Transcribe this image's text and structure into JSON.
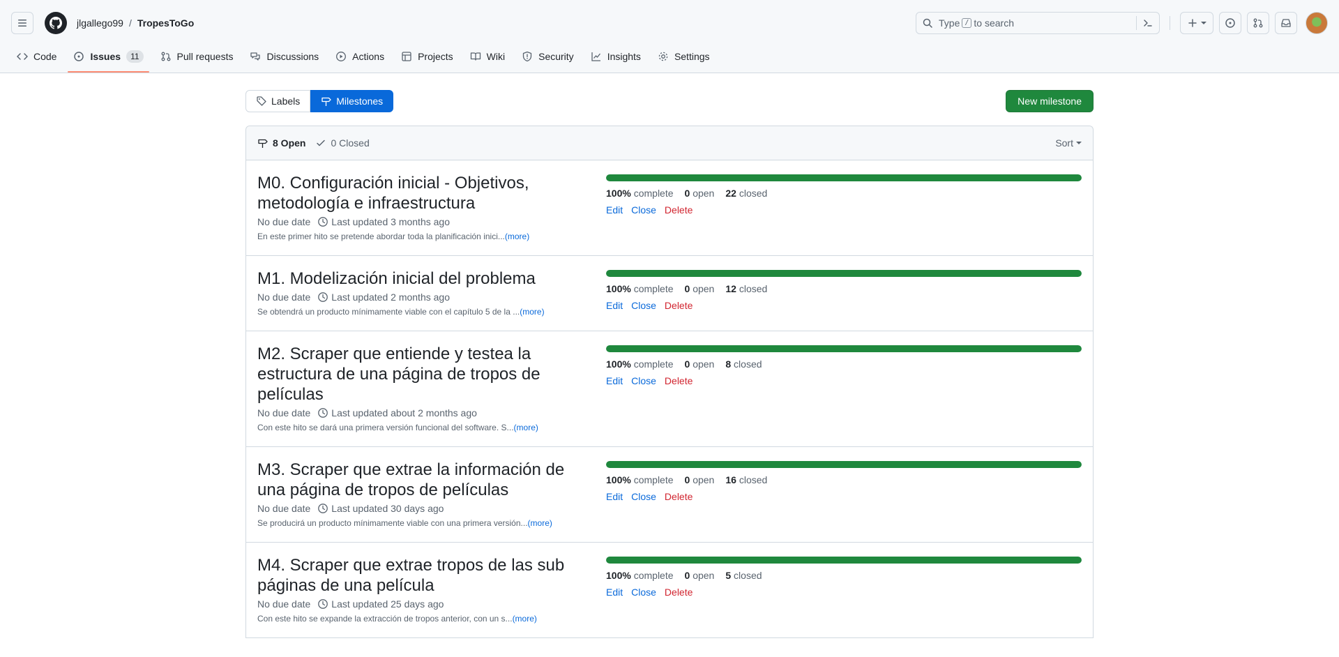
{
  "header": {
    "owner": "jlgallego99",
    "separator": "/",
    "repo": "TropesToGo",
    "search_prefix": "Type",
    "search_key": "/",
    "search_suffix": "to search"
  },
  "nav": {
    "tabs": [
      {
        "label": "Code",
        "icon": "code-icon"
      },
      {
        "label": "Issues",
        "icon": "issue-opened-icon",
        "count": "11",
        "active": true
      },
      {
        "label": "Pull requests",
        "icon": "git-pull-request-icon"
      },
      {
        "label": "Discussions",
        "icon": "comment-discussion-icon"
      },
      {
        "label": "Actions",
        "icon": "play-icon"
      },
      {
        "label": "Projects",
        "icon": "table-icon"
      },
      {
        "label": "Wiki",
        "icon": "book-icon"
      },
      {
        "label": "Security",
        "icon": "shield-icon"
      },
      {
        "label": "Insights",
        "icon": "graph-icon"
      },
      {
        "label": "Settings",
        "icon": "gear-icon"
      }
    ]
  },
  "toolbar": {
    "labels_label": "Labels",
    "milestones_label": "Milestones",
    "new_milestone_label": "New milestone"
  },
  "list": {
    "open_label": "8 Open",
    "closed_label": "0 Closed",
    "sort_label": "Sort"
  },
  "milestones": [
    {
      "title": "M0. Configuración inicial - Objetivos, metodología e infraestructura",
      "due": "No due date",
      "updated": "Last updated 3 months ago",
      "desc": "En este primer hito se pretende abordar toda la planificación inici...",
      "more": "(more)",
      "progress": 100,
      "percent": "100%",
      "complete_label": "complete",
      "open": "0",
      "open_label": "open",
      "closed": "22",
      "closed_label": "closed",
      "edit": "Edit",
      "close": "Close",
      "delete": "Delete"
    },
    {
      "title": "M1. Modelización inicial del problema",
      "due": "No due date",
      "updated": "Last updated 2 months ago",
      "desc": "Se obtendrá un producto mínimamente viable con el capítulo 5 de la ...",
      "more": "(more)",
      "progress": 100,
      "percent": "100%",
      "complete_label": "complete",
      "open": "0",
      "open_label": "open",
      "closed": "12",
      "closed_label": "closed",
      "edit": "Edit",
      "close": "Close",
      "delete": "Delete"
    },
    {
      "title": "M2. Scraper que entiende y testea la estructura de una página de tropos de películas",
      "due": "No due date",
      "updated": "Last updated about 2 months ago",
      "desc": "Con este hito se dará una primera versión funcional del software. S...",
      "more": "(more)",
      "progress": 100,
      "percent": "100%",
      "complete_label": "complete",
      "open": "0",
      "open_label": "open",
      "closed": "8",
      "closed_label": "closed",
      "edit": "Edit",
      "close": "Close",
      "delete": "Delete"
    },
    {
      "title": "M3. Scraper que extrae la información de una página de tropos de películas",
      "due": "No due date",
      "updated": "Last updated 30 days ago",
      "desc": "Se producirá un producto mínimamente viable con una primera versión...",
      "more": "(more)",
      "progress": 100,
      "percent": "100%",
      "complete_label": "complete",
      "open": "0",
      "open_label": "open",
      "closed": "16",
      "closed_label": "closed",
      "edit": "Edit",
      "close": "Close",
      "delete": "Delete"
    },
    {
      "title": "M4. Scraper que extrae tropos de las sub páginas de una película",
      "due": "No due date",
      "updated": "Last updated 25 days ago",
      "desc": "Con este hito se expande la extracción de tropos anterior, con un s...",
      "more": "(more)",
      "progress": 100,
      "percent": "100%",
      "complete_label": "complete",
      "open": "0",
      "open_label": "open",
      "closed": "5",
      "closed_label": "closed",
      "edit": "Edit",
      "close": "Close",
      "delete": "Delete"
    }
  ],
  "colors": {
    "accent": "#0969da",
    "success": "#1f883d",
    "danger": "#d1242f",
    "tab_underline": "#fd8c73"
  }
}
